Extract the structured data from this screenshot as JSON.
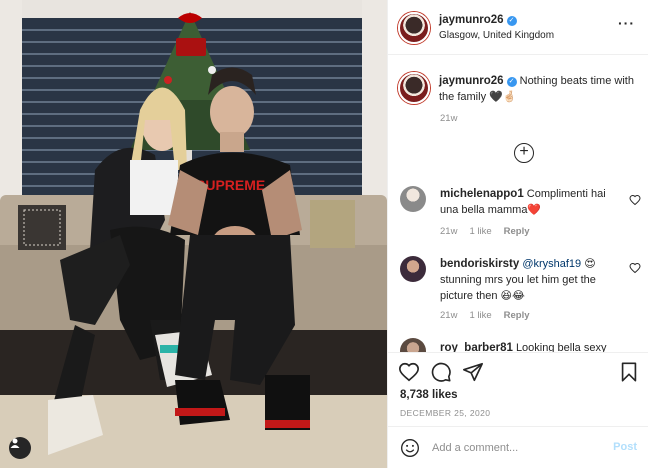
{
  "post": {
    "author": {
      "username": "jaymunro26",
      "location": "Glasgow, United Kingdom",
      "verified": true
    },
    "caption": {
      "text": "Nothing beats time with the family 🖤🤞🏻",
      "time": "21w"
    },
    "comments": [
      {
        "username": "michelenappo1",
        "text": "Complimenti hai una bella mamma❤️",
        "time": "21w",
        "likes": "1 like",
        "reply": "Reply"
      },
      {
        "username": "bendoriskirsty",
        "mention": "@kryshaf19",
        "text": "😍 stunning mrs you let him get the picture then 😆😂",
        "time": "21w",
        "likes": "1 like",
        "reply": "Reply"
      },
      {
        "username": "roy_barber81",
        "text": "Looking bella sexy"
      }
    ],
    "likes_count": "8,738 likes",
    "date": "DECEMBER 25, 2020",
    "comment_box": {
      "placeholder": "Add a comment...",
      "post_label": "Post"
    }
  },
  "colors": {
    "accent_blue": "#3897f0",
    "post_disabled": "#b2dffc",
    "muted_text": "#8e8e8e",
    "heart_red": "#ed4956"
  },
  "icons": [
    "more-icon",
    "verified-icon",
    "load-more-icon",
    "heart-icon",
    "comment-icon",
    "share-icon",
    "bookmark-icon",
    "emoji-icon",
    "user-tag-icon"
  ]
}
